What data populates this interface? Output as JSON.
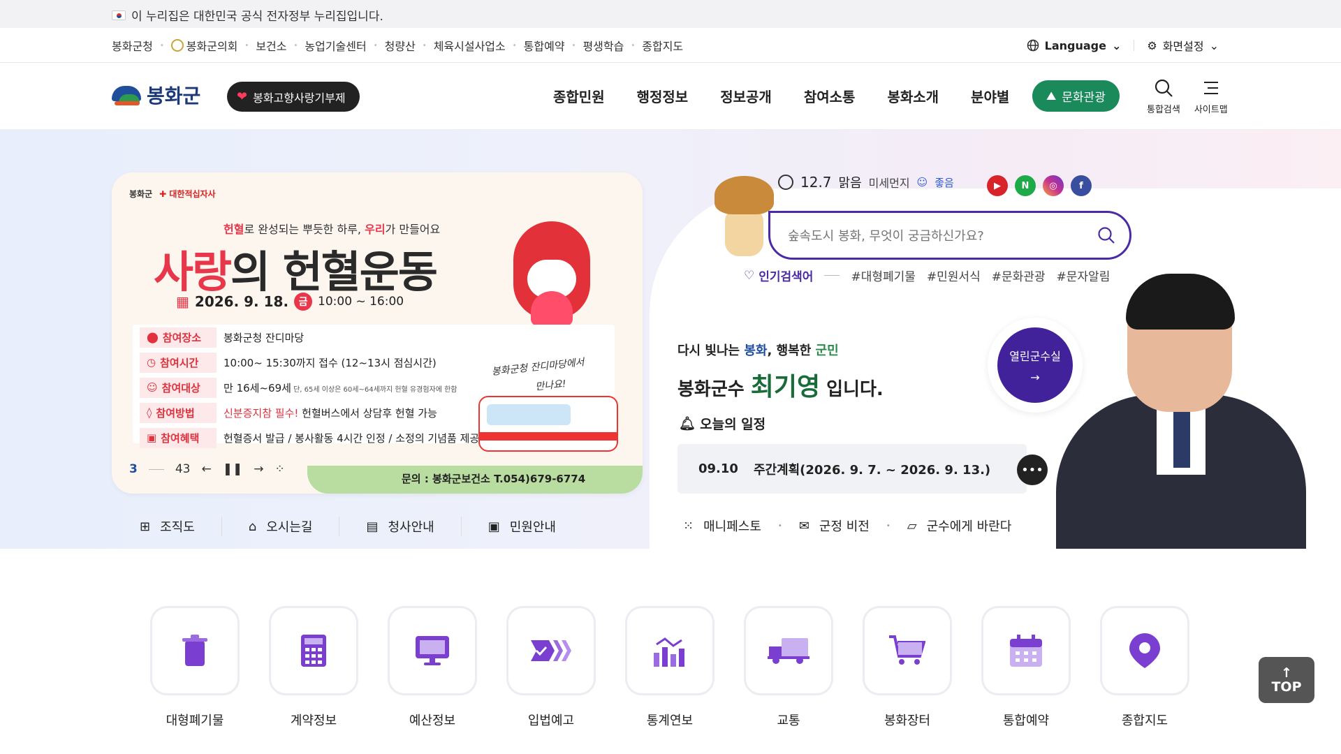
{
  "gov_bar": {
    "text": "이 누리집은 대한민국 공식 전자정부 누리집입니다."
  },
  "util_links": [
    "봉화군청",
    "봉화군의회",
    "보건소",
    "농업기술센터",
    "청량산",
    "체육시설사업소",
    "통합예약",
    "평생학습",
    "종합지도"
  ],
  "util_right": {
    "language": "Language",
    "display": "화면설정"
  },
  "header": {
    "logo": "봉화군",
    "gift_btn": "봉화고향사랑기부제",
    "gnb": [
      "종합민원",
      "행정정보",
      "정보공개",
      "참여소통",
      "봉화소개",
      "분야별"
    ],
    "culture_btn": "문화관광",
    "search_label": "통합검색",
    "sitemap_label": "사이트맵"
  },
  "banner": {
    "logo1": "봉화군",
    "logo2": "대한적십자사",
    "subtitle_a": "헌혈",
    "subtitle_b": "로 완성되는 뿌듯한 하루, ",
    "subtitle_c": "우리",
    "subtitle_d": "가 만들어요",
    "title_red": "사랑",
    "title_rest": "의 헌혈운동",
    "date": "2026. 9. 18.",
    "day": "금",
    "time": "10:00 ~ 16:00",
    "rows": [
      {
        "k": "참여장소",
        "v": "봉화군청 잔디마당",
        "small": "",
        "red": ""
      },
      {
        "k": "참여시간",
        "v": "10:00~ 15:30까지 접수 (12~13시 점심시간)",
        "small": "",
        "red": ""
      },
      {
        "k": "참여대상",
        "v": "만 16세~69세",
        "small": " 단, 65세 이상은 60세~64세까지 헌혈 유경험자에 한함",
        "red": ""
      },
      {
        "k": "참여방법",
        "v": " 헌혈버스에서 상담후 헌혈 가능",
        "small": "",
        "red": "신분증지참 필수!"
      },
      {
        "k": "참여혜택",
        "v": "헌혈증서 발급 / 봉사활동 4시간 인정 / 소정의 기념품 제공",
        "small": "",
        "red": ""
      }
    ],
    "handwriting1": "봉화군청 잔디마당에서",
    "handwriting2": "만나요!",
    "contact": "문의 : 봉화군보건소 T.054)679-6774"
  },
  "slider": {
    "current": "3",
    "total": "43"
  },
  "quick_links": [
    "조직도",
    "오시는길",
    "청사안내",
    "민원안내"
  ],
  "weather": {
    "temp": "12.7",
    "sky": "맑음",
    "dust_label": "미세먼지",
    "dust_value": "좋음"
  },
  "sns": [
    "youtube",
    "naver-blog",
    "instagram",
    "facebook"
  ],
  "search": {
    "placeholder": "숲속도시 봉화, 무엇이 궁금하신가요?"
  },
  "popular": {
    "label": "인기검색어",
    "tags": [
      "#대형폐기물",
      "#민원서식",
      "#문화관광",
      "#문자알림"
    ]
  },
  "mayor": {
    "slogan_a": "다시 빛나는 ",
    "slogan_b": "봉화",
    "slogan_c": ", 행복한 ",
    "slogan_d": "군민",
    "intro": "봉화군수 ",
    "name": "최기영",
    "suffix": " 입니다.",
    "open_label": "열린군수실"
  },
  "schedule": {
    "title": "오늘의 일정",
    "date": "09.10",
    "text": "주간계획(2026. 9. 7. ~ 2026. 9. 13.)"
  },
  "mayor_links": [
    "매니페스토",
    "군정 비전",
    "군수에게 바란다"
  ],
  "services": [
    "대형폐기물",
    "계약정보",
    "예산정보",
    "입법예고",
    "통계연보",
    "교통",
    "봉화장터",
    "통합예약",
    "종합지도"
  ],
  "top_btn": "TOP",
  "colors": {
    "accent": "#6a2fc9",
    "brand": "#1f4e9c",
    "culture": "#1a8a5a",
    "red": "#e8374a"
  }
}
